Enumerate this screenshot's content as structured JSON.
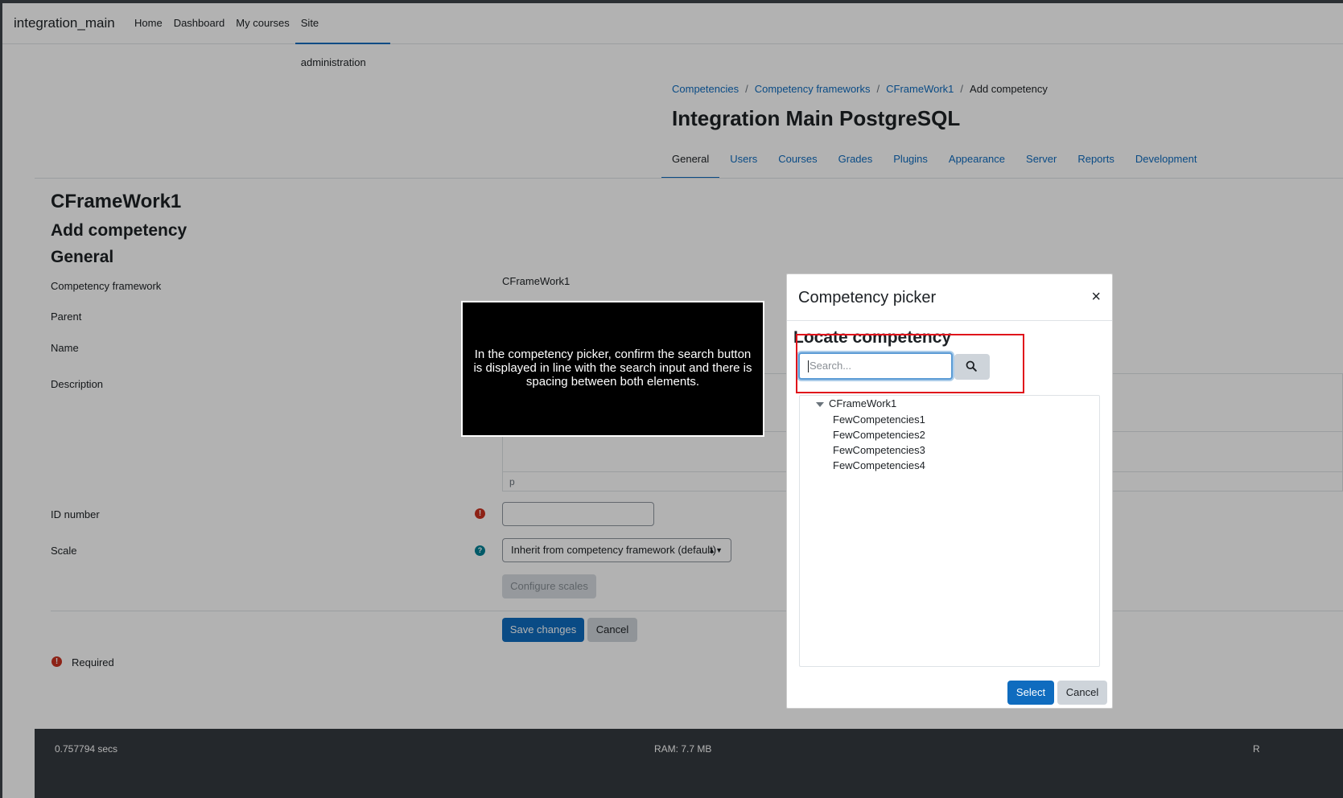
{
  "site": {
    "brand": "integration_main",
    "nav": [
      "Home",
      "Dashboard",
      "My courses",
      "Site administration"
    ]
  },
  "breadcrumb": {
    "items": [
      "Competencies",
      "Competency frameworks",
      "CFrameWork1"
    ],
    "current": "Add competency",
    "sep": "/"
  },
  "header": {
    "title": "Integration Main PostgreSQL",
    "tabs": [
      "General",
      "Users",
      "Courses",
      "Grades",
      "Plugins",
      "Appearance",
      "Server",
      "Reports",
      "Development"
    ]
  },
  "page": {
    "framework_heading": "CFrameWork1",
    "add_heading": "Add competency",
    "section_heading": "General"
  },
  "form": {
    "framework_label": "Competency framework",
    "framework_value": "CFrameWork1",
    "parent_label": "Parent",
    "name_label": "Name",
    "description_label": "Description",
    "editor_status": "p",
    "idnumber_label": "ID number",
    "scale_label": "Scale",
    "scale_value": "Inherit from competency framework (default)",
    "configure_scales": "Configure scales",
    "save_changes": "Save changes",
    "cancel": "Cancel",
    "required_label": "Required"
  },
  "footer": {
    "time": "0.757794 secs",
    "ram": "RAM: 7.7 MB",
    "right": "R"
  },
  "callout": {
    "text": "In the competency picker, confirm the search button is displayed in line with the search input and there is spacing between both elements."
  },
  "modal": {
    "title": "Competency picker",
    "close": "×",
    "locate_heading": "Locate competency",
    "search_placeholder": "Search...",
    "tree_root": "CFrameWork1",
    "tree_children": [
      "FewCompetencies1",
      "FewCompetencies2",
      "FewCompetencies3",
      "FewCompetencies4"
    ],
    "select": "Select",
    "cancel": "Cancel"
  },
  "colors": {
    "primary": "#0f6cbf",
    "highlight": "#e0131b",
    "required": "#ca3120",
    "help": "#008196"
  }
}
